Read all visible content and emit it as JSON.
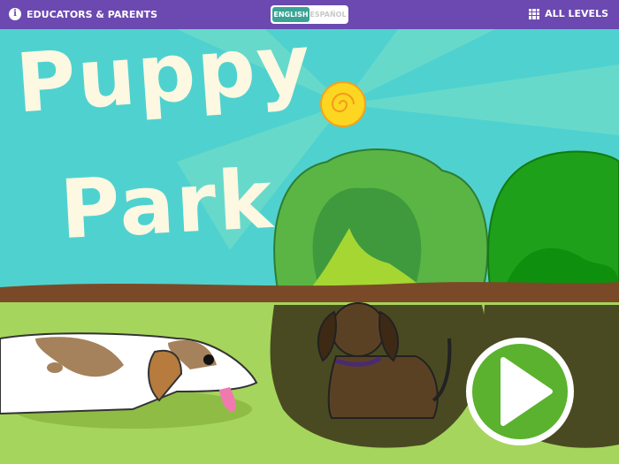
{
  "header": {
    "educators_label": "EDUCATORS & PARENTS",
    "language_options": [
      "ENGLISH",
      "ESPAÑOL"
    ],
    "selected_language": "ENGLISH",
    "all_levels_label": "ALL LEVELS"
  },
  "game": {
    "title_line1": "Puppy",
    "title_line2": "Park"
  },
  "colors": {
    "header": "#6b49b0",
    "sky": "#4fd2cf",
    "grass": "#a6d55d",
    "play": "#5ab22e"
  }
}
